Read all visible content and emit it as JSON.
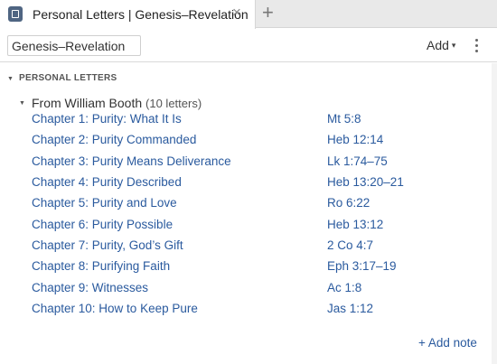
{
  "tab": {
    "title": "Personal Letters | Genesis–Revelation",
    "close_glyph": "×",
    "new_tab_glyph": "+"
  },
  "toolbar": {
    "range_value": "Genesis–Revelation",
    "add_label": "Add",
    "add_caret": "▾"
  },
  "section": {
    "caret": "▼",
    "title": "PERSONAL LETTERS"
  },
  "group": {
    "caret": "▼",
    "title": "From William Booth",
    "count": "(10 letters)"
  },
  "letters": [
    {
      "title": "Chapter 1: Purity: What It Is",
      "ref": "Mt 5:8"
    },
    {
      "title": "Chapter 2: Purity Commanded",
      "ref": "Heb 12:14"
    },
    {
      "title": "Chapter 3: Purity Means Deliverance",
      "ref": "Lk 1:74–75"
    },
    {
      "title": "Chapter 4: Purity Described",
      "ref": "Heb 13:20–21"
    },
    {
      "title": "Chapter 5: Purity and Love",
      "ref": "Ro 6:22"
    },
    {
      "title": "Chapter 6: Purity Possible",
      "ref": "Heb 13:12"
    },
    {
      "title": "Chapter 7: Purity, God’s Gift",
      "ref": "2 Co 4:7"
    },
    {
      "title": "Chapter 8: Purifying Faith",
      "ref": "Eph 3:17–19"
    },
    {
      "title": "Chapter 9: Witnesses",
      "ref": "Ac 1:8"
    },
    {
      "title": "Chapter 10: How to Keep Pure",
      "ref": "Jas 1:12"
    }
  ],
  "footer": {
    "add_note_label": "+ Add note"
  },
  "icons": {
    "tab_icon": "book-icon",
    "more": "more-vertical-icon"
  },
  "colors": {
    "link": "#2a5a9e",
    "tab_icon": "#4f6582",
    "tabbar_bg": "#e9e9e9"
  }
}
